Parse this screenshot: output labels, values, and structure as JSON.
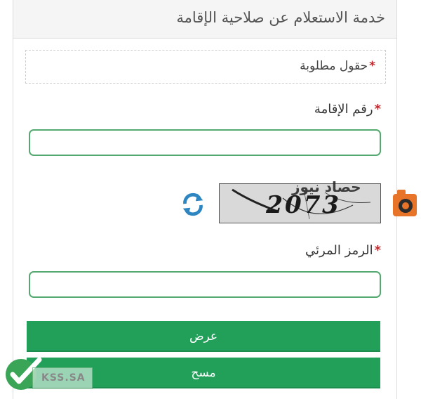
{
  "header": {
    "title": "خدمة الاستعلام عن صلاحية الإقامة"
  },
  "required_note": {
    "star": "*",
    "text": "حقول مطلوبة"
  },
  "residency_field": {
    "label": "رقم الإقامة",
    "star": "*",
    "value": "",
    "placeholder": ""
  },
  "captcha": {
    "text": "2073",
    "refresh_icon": "refresh-icon"
  },
  "captcha_field": {
    "label": "الرمز المرئي",
    "star": "*",
    "value": "",
    "placeholder": ""
  },
  "buttons": {
    "show_label": "عرض",
    "clear_label": "مسح"
  },
  "watermarks": {
    "site_text": "حصاد نيوز",
    "kss_text": "KSS.SA"
  },
  "colors": {
    "accent_green": "#22a05a",
    "input_border": "#55a86f",
    "required_star": "#c0272d",
    "refresh_blue": "#2e86c1"
  }
}
